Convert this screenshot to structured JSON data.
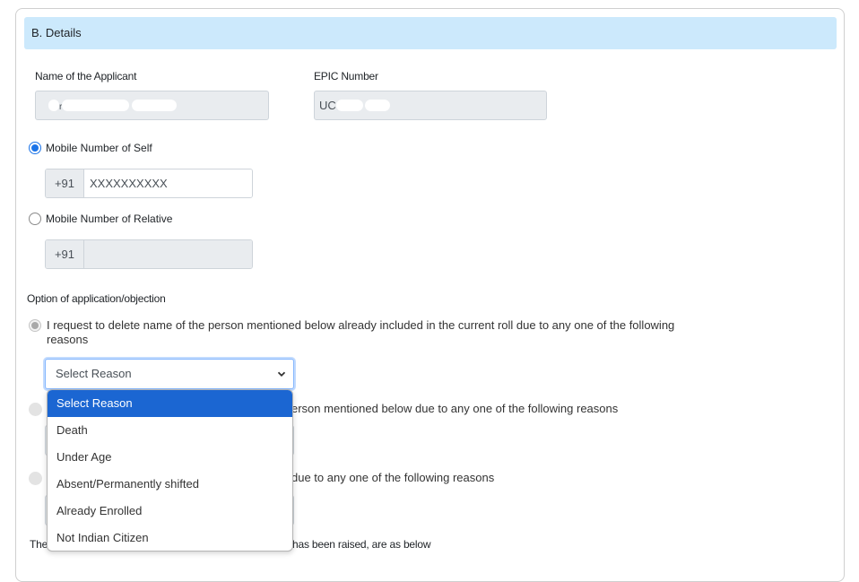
{
  "section": {
    "title": "B. Details"
  },
  "applicant": {
    "name_label": "Name of the Applicant",
    "name_value_visible": "r",
    "name_masked": true,
    "epic_label": "EPIC Number",
    "epic_value_visible": "UC",
    "epic_masked": true
  },
  "mobile": {
    "self_label": "Mobile Number of Self",
    "self_checked": true,
    "self_prefix": "+91",
    "self_value": "XXXXXXXXXX",
    "relative_label": "Mobile Number of Relative",
    "relative_checked": false,
    "relative_prefix": "+91",
    "relative_value": ""
  },
  "application": {
    "heading": "Option of application/objection",
    "options": [
      {
        "text": "I request to delete name of the person mentioned below already included in the current roll due to any one of the following reasons",
        "checked": true,
        "select_value": "Select Reason"
      },
      {
        "text_visible": "erson mentioned below due to any one of the following reasons",
        "checked": false
      },
      {
        "text_visible": "due to any one of the following reasons",
        "checked": false
      }
    ],
    "footer_text_start": "The",
    "footer_text_end": "has been raised, are as below"
  },
  "dropdown": {
    "open": true,
    "selected_index": 0,
    "items": [
      "Select Reason",
      "Death",
      "Under Age",
      "Absent/Permanently shifted",
      "Already Enrolled",
      "Not Indian Citizen"
    ]
  },
  "colors": {
    "header_bg": "#cce9fc",
    "accent": "#1a73e8",
    "dropdown_selected": "#1b66d2",
    "readonly_bg": "#e9ecef"
  }
}
